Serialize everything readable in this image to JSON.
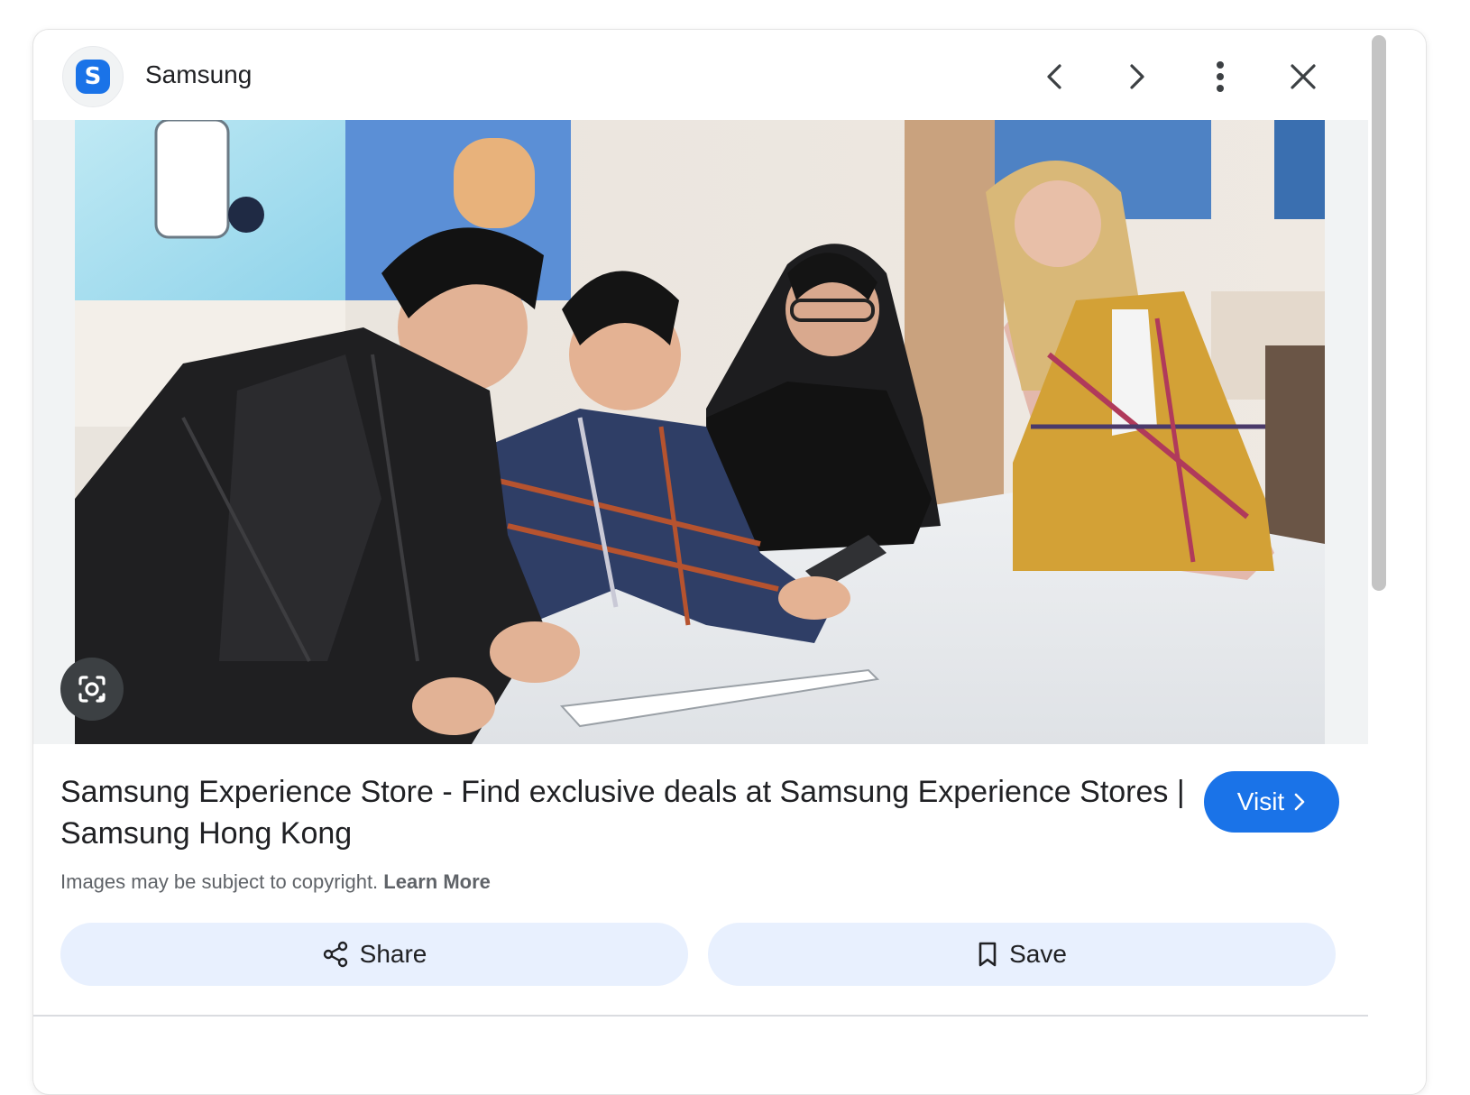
{
  "header": {
    "favicon_letter": "S",
    "site_name": "Samsung",
    "prev_icon": "chevron-left-icon",
    "next_icon": "chevron-right-icon",
    "more_icon": "more-vert-icon",
    "close_icon": "close-icon"
  },
  "image": {
    "lens_icon": "google-lens-icon"
  },
  "result": {
    "title": "Samsung Experience Store - Find exclusive deals at Samsung Experience Stores | Samsung Hong Kong",
    "visit_label": "Visit",
    "copyright_text": "Images may be subject to copyright.",
    "learn_more_label": "Learn More"
  },
  "actions": {
    "share_label": "Share",
    "save_label": "Save"
  },
  "colors": {
    "accent": "#1a73e8",
    "action_bg": "#e8f0fe",
    "text": "#202124",
    "muted": "#5f6368"
  }
}
